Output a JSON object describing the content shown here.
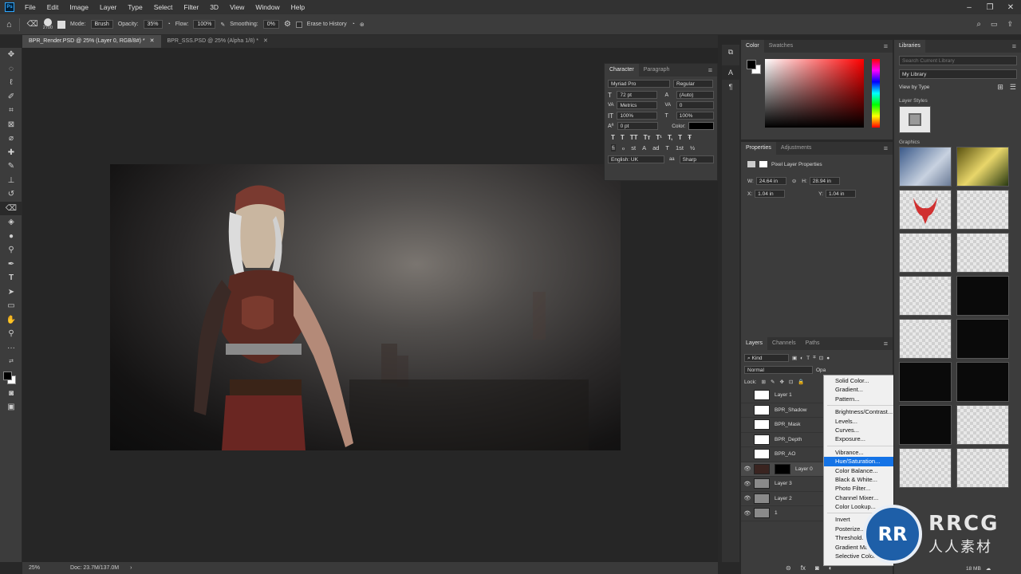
{
  "menu": [
    "File",
    "Edit",
    "Image",
    "Layer",
    "Type",
    "Select",
    "Filter",
    "3D",
    "View",
    "Window",
    "Help"
  ],
  "options": {
    "brush_size": "2700",
    "mode_label": "Mode:",
    "mode_value": "Brush",
    "opacity_label": "Opacity:",
    "opacity_value": "35%",
    "flow_label": "Flow:",
    "flow_value": "100%",
    "smoothing_label": "Smoothing:",
    "smoothing_value": "0%",
    "erase_history": "Erase to History"
  },
  "tabs": [
    {
      "label": "BPR_Render.PSD @ 25% (Layer 0, RGB/8#) *",
      "active": true
    },
    {
      "label": "BPR_SSS.PSD @ 25% (Alpha 1/8) *",
      "active": false
    }
  ],
  "status": {
    "zoom": "25%",
    "doc": "Doc: 23.7M/137.0M"
  },
  "character": {
    "tabs": [
      "Character",
      "Paragraph"
    ],
    "font": "Myriad Pro",
    "style": "Regular",
    "size": "72 pt",
    "leading": "(Auto)",
    "kerning": "Metrics",
    "tracking": "0",
    "vscale": "100%",
    "hscale": "100%",
    "baseline": "0 pt",
    "color_label": "Color:",
    "language": "English: UK",
    "antialias": "Sharp",
    "buttons": [
      "T",
      "T",
      "TT",
      "Tт",
      "T¹",
      "T,",
      "T",
      "Ŧ"
    ],
    "buttons2": [
      "fi",
      "ℴ",
      "st",
      "A",
      "ad",
      "T",
      "1st",
      "½"
    ]
  },
  "color_panel": {
    "tabs": [
      "Color",
      "Swatches"
    ]
  },
  "properties": {
    "tabs": [
      "Properties",
      "Adjustments"
    ],
    "title": "Pixel Layer Properties",
    "w_label": "W:",
    "w": "24.64 in",
    "h_label": "H:",
    "h": "28.94 in",
    "x_label": "X:",
    "x": "1.04 in",
    "y_label": "Y:",
    "y": "1.04 in"
  },
  "layers_panel": {
    "tabs": [
      "Layers",
      "Channels",
      "Paths"
    ],
    "kind": "Kind",
    "blend": "Normal",
    "opacity_short": "Opa",
    "lock_label": "Lock:",
    "layers": [
      {
        "name": "Layer 1",
        "visible": false
      },
      {
        "name": "BPR_Shadow",
        "visible": false
      },
      {
        "name": "BPR_Mask",
        "visible": false
      },
      {
        "name": "BPR_Depth",
        "visible": false
      },
      {
        "name": "BPR_AO",
        "visible": false
      },
      {
        "name": "Layer 0",
        "visible": true
      },
      {
        "name": "Layer 3",
        "visible": true
      },
      {
        "name": "Layer 2",
        "visible": true
      },
      {
        "name": "1",
        "visible": true
      }
    ]
  },
  "context_menu": {
    "groups": [
      [
        "Solid Color...",
        "Gradient...",
        "Pattern..."
      ],
      [
        "Brightness/Contrast...",
        "Levels...",
        "Curves...",
        "Exposure..."
      ],
      [
        "Vibrance...",
        "Hue/Saturation...",
        "Color Balance...",
        "Black & White...",
        "Photo Filter...",
        "Channel Mixer...",
        "Color Lookup..."
      ],
      [
        "Invert",
        "Posterize...",
        "Threshold...",
        "Gradient Map...",
        "Selective Color..."
      ]
    ],
    "highlighted": "Hue/Saturation..."
  },
  "libraries": {
    "title": "Libraries",
    "search_placeholder": "Search Current Library",
    "library": "My Library",
    "view_by": "View by Type",
    "layer_styles": "Layer Styles",
    "graphics": "Graphics",
    "size": "18 MB"
  },
  "watermark": {
    "brand": "RRCG",
    "sub": "人人素材"
  }
}
